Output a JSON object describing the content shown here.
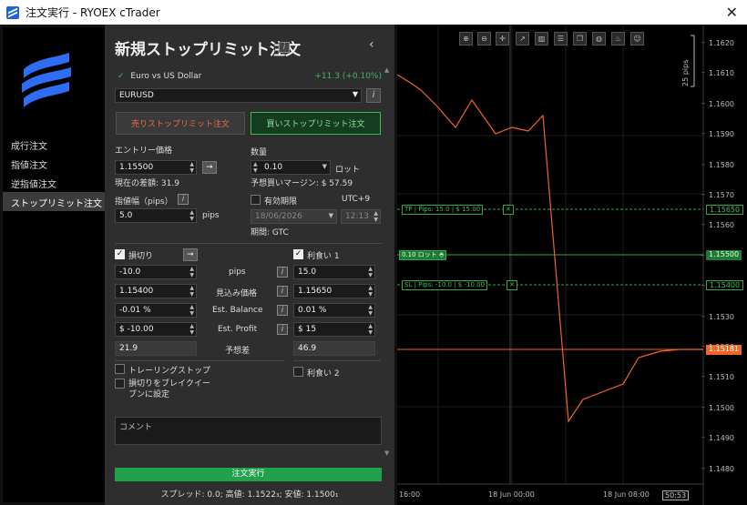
{
  "window": {
    "title": "注文実行 - RYOEX cTrader",
    "close_symbol": "✕"
  },
  "nav": {
    "items": [
      {
        "label": "成行注文",
        "active": false
      },
      {
        "label": "指値注文",
        "active": false
      },
      {
        "label": "逆指値注文",
        "active": false
      },
      {
        "label": "ストップリミット注文",
        "active": true
      }
    ]
  },
  "panel": {
    "title": "新規ストップリミット注文",
    "info_glyph": "i",
    "collapse_glyph": "‹",
    "symbol_full": "Euro vs US Dollar",
    "symbol_change": "+11.3 (+0.10%)",
    "symbol_code": "EURUSD",
    "sell_button": "売りストップリミット注文",
    "buy_button": "買いストップリミット注文",
    "entry_label": "エントリー価格",
    "entry_value": "1.15500",
    "entry_diff": "現在の差額: 31.9",
    "quantity_label": "数量",
    "quantity_value": "0.10",
    "quantity_unit": "ロット",
    "margin_text": "予想買いマージン: $ 57.59",
    "limit_range_label": "指値幅（pips）",
    "limit_range_value": "5.0",
    "limit_range_unit": "pips",
    "expiry_label": "有効期限",
    "timezone": "UTC+9",
    "expiry_date": "18/06/2026",
    "expiry_time": "12:13",
    "period_text": "期間: GTC",
    "stop_loss_label": "損切り",
    "take_profit_label": "利食い 1",
    "row_labels": [
      "pips",
      "見込み価格",
      "Est. Balance",
      "Est. Profit",
      "予想差"
    ],
    "sl_values": [
      "-10.0",
      "1.15400",
      "-0.01 %",
      "$ -10.00",
      "21.9"
    ],
    "tp_values": [
      "15.0",
      "1.15650",
      "0.01 %",
      "$ 15",
      "46.9"
    ],
    "trailing_stop_label": "トレーリングストップ",
    "breakeven_label": "損切りをブレイクイーブンに設定",
    "take_profit_2_label": "利食い 2",
    "comment_placeholder": "コメント",
    "submit_label": "注文実行",
    "footer_stats": "スプレッド: 0.0; 高値: 1.1522₃; 安値: 1.1500₁"
  },
  "chart": {
    "toolbar_icons": [
      "zoom-in-icon",
      "zoom-out-icon",
      "crosshair-icon",
      "line-chart-icon",
      "bar-chart-icon",
      "list-icon",
      "copy-icon",
      "globe-icon",
      "fire-icon",
      "user-icon"
    ],
    "toolbar_glyphs": [
      "⊕",
      "⊖",
      "✛",
      "↗",
      "▥",
      "☰",
      "❐",
      "◍",
      "♨",
      "☺"
    ],
    "price_axis": [
      "1.1620",
      "1.1610",
      "1.1600",
      "1.1590",
      "1.1580",
      "1.1570",
      "1.1560",
      "1.1550",
      "1.1540",
      "1.1530",
      "1.1520",
      "1.1510",
      "1.1500",
      "1.1490",
      "1.1480"
    ],
    "price_axis_prefix": "_",
    "pips_label": "25 pips",
    "tp_line": {
      "side": "TP",
      "pips": "Pips: 15.0",
      "amount": "$ 15.00",
      "price": "1.15650"
    },
    "entry_line": {
      "size": "0.10 ロット",
      "price": "1.15500"
    },
    "sl_line": {
      "side": "SL",
      "pips": "Pips: -10.0",
      "amount": "$ -10.00",
      "price": "1.15400"
    },
    "current_price": "1.15181",
    "time_axis": [
      "16:00",
      "18 Jun 00:00",
      "18 Jun 08:00"
    ],
    "time_cursor": "50:53",
    "colors": {
      "line": "#f26522",
      "tp_sl": "#2ea84a",
      "bid": "#f26522"
    }
  }
}
